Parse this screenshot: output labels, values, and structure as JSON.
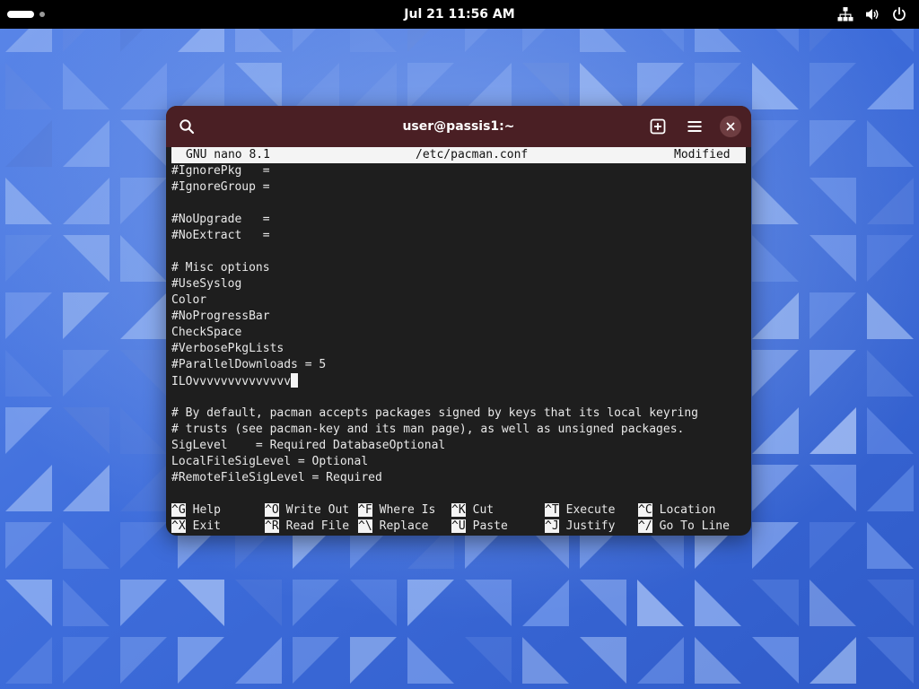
{
  "topbar": {
    "clock": "Jul 21  11:56 AM",
    "icons": [
      "network-icon",
      "volume-icon",
      "power-icon"
    ]
  },
  "window": {
    "title": "user@passis1:~",
    "header_color": "#4a1f24",
    "buttons": [
      "search-icon",
      "new-tab-icon",
      "hamburger-menu-icon",
      "close-icon"
    ]
  },
  "nano": {
    "version": "GNU nano 8.1",
    "filename": "/etc/pacman.conf",
    "status": "Modified",
    "lines": [
      "#IgnorePkg   =",
      "#IgnoreGroup =",
      "",
      "#NoUpgrade   =",
      "#NoExtract   =",
      "",
      "# Misc options",
      "#UseSyslog",
      "Color",
      "#NoProgressBar",
      "CheckSpace",
      "#VerbosePkgLists",
      "#ParallelDownloads = 5",
      "ILOvvvvvvvvvvvvvv",
      "",
      "# By default, pacman accepts packages signed by keys that its local keyring",
      "# trusts (see pacman-key and its man page), as well as unsigned packages.",
      "SigLevel    = Required DatabaseOptional",
      "LocalFileSigLevel = Optional",
      "#RemoteFileSigLevel = Required"
    ],
    "cursor_line": 13,
    "shortcuts": [
      [
        {
          "key": "^G",
          "label": "Help"
        },
        {
          "key": "^O",
          "label": "Write Out"
        },
        {
          "key": "^F",
          "label": "Where Is"
        },
        {
          "key": "^K",
          "label": "Cut"
        },
        {
          "key": "^T",
          "label": "Execute"
        },
        {
          "key": "^C",
          "label": "Location"
        }
      ],
      [
        {
          "key": "^X",
          "label": "Exit"
        },
        {
          "key": "^R",
          "label": "Read File"
        },
        {
          "key": "^\\",
          "label": "Replace"
        },
        {
          "key": "^U",
          "label": "Paste"
        },
        {
          "key": "^J",
          "label": "Justify"
        },
        {
          "key": "^/",
          "label": "Go To Line"
        }
      ]
    ]
  }
}
